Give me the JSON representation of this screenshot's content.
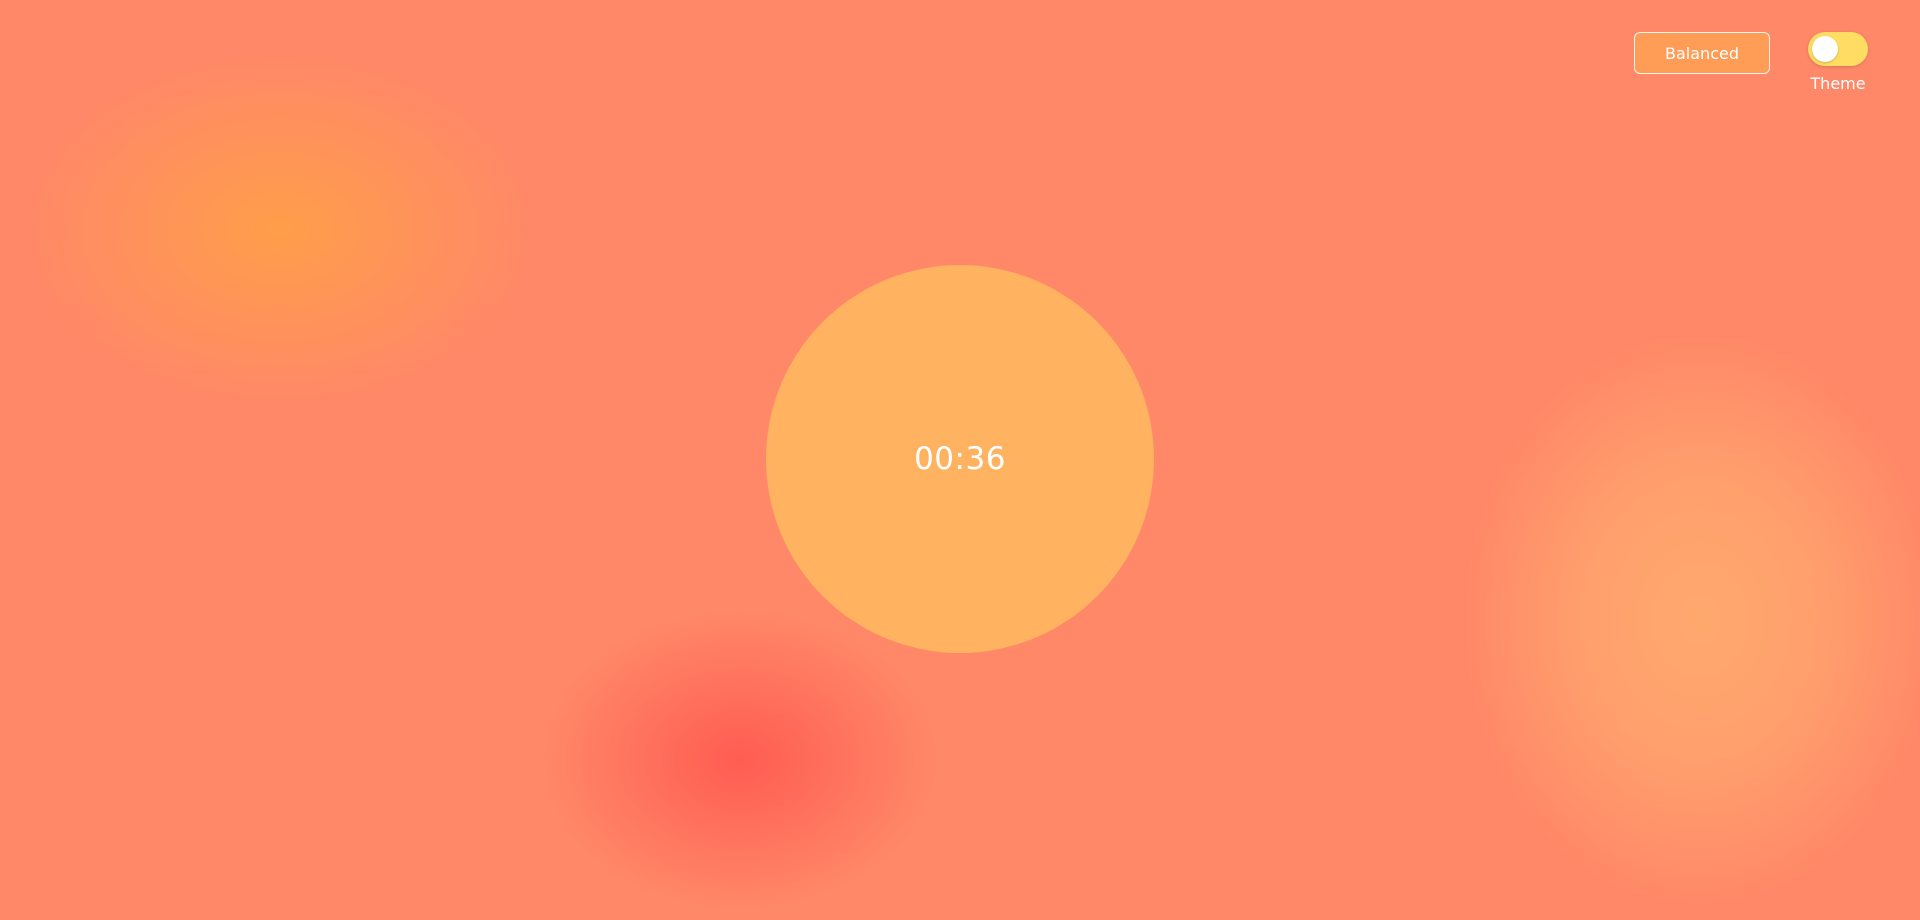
{
  "timer": {
    "display": "00:36"
  },
  "mode_button": {
    "label": "Balanced"
  },
  "theme_toggle": {
    "label": "Theme",
    "on": false
  },
  "colors": {
    "background": "#ff8868",
    "timer_circle": "#ffb25f",
    "mode_button": "#ff9c55",
    "toggle_track": "#ffdc62",
    "text": "#ffffff"
  }
}
